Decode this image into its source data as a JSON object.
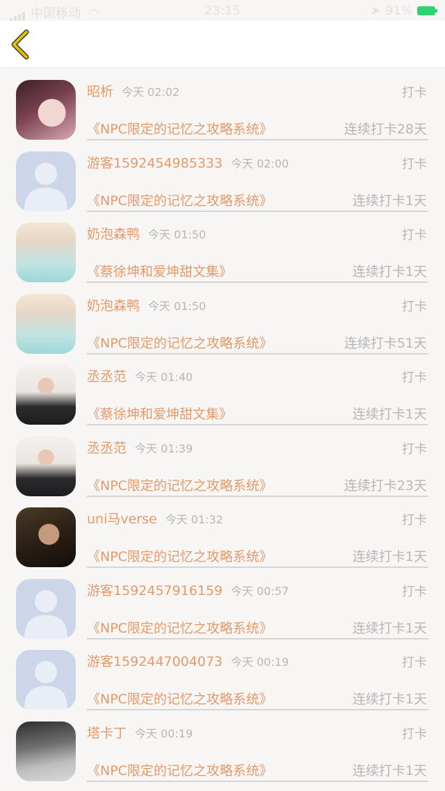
{
  "status_bar": {
    "carrier": "中国移动",
    "time": "23:15",
    "battery": "91%"
  },
  "nav": {
    "back_icon": "chevron-left-icon",
    "accent_color": "#e6c200"
  },
  "colors": {
    "name": "#e39a69",
    "meta": "#b6b6b6"
  },
  "entries": [
    {
      "avatar": "photo",
      "name": "昭析",
      "time": "今天 02:02",
      "action": "打卡",
      "book": "《NPC限定的记忆之攻略系统》",
      "streak": "连续打卡28天"
    },
    {
      "avatar": "default",
      "name": "游客1592454985333",
      "time": "今天 02:00",
      "action": "打卡",
      "book": "《NPC限定的记忆之攻略系统》",
      "streak": "连续打卡1天"
    },
    {
      "avatar": "photo",
      "name": "奶泡森鸭",
      "time": "今天 01:50",
      "action": "打卡",
      "book": "《蔡徐坤和爱坤甜文集》",
      "streak": "连续打卡1天"
    },
    {
      "avatar": "photo",
      "name": "奶泡森鸭",
      "time": "今天 01:50",
      "action": "打卡",
      "book": "《NPC限定的记忆之攻略系统》",
      "streak": "连续打卡51天"
    },
    {
      "avatar": "photo",
      "name": "丞丞范",
      "time": "今天 01:40",
      "action": "打卡",
      "book": "《蔡徐坤和爱坤甜文集》",
      "streak": "连续打卡1天"
    },
    {
      "avatar": "photo",
      "name": "丞丞范",
      "time": "今天 01:39",
      "action": "打卡",
      "book": "《NPC限定的记忆之攻略系统》",
      "streak": "连续打卡23天"
    },
    {
      "avatar": "photo",
      "name": "uni马verse",
      "time": "今天 01:32",
      "action": "打卡",
      "book": "《NPC限定的记忆之攻略系统》",
      "streak": "连续打卡1天"
    },
    {
      "avatar": "default",
      "name": "游客1592457916159",
      "time": "今天 00:57",
      "action": "打卡",
      "book": "《NPC限定的记忆之攻略系统》",
      "streak": "连续打卡1天"
    },
    {
      "avatar": "default",
      "name": "游客1592447004073",
      "time": "今天 00:19",
      "action": "打卡",
      "book": "《NPC限定的记忆之攻略系统》",
      "streak": "连续打卡1天"
    },
    {
      "avatar": "photo",
      "name": "塔卡丁",
      "time": "今天 00:19",
      "action": "打卡",
      "book": "《NPC限定的记忆之攻略系统》",
      "streak": "连续打卡1天"
    }
  ]
}
